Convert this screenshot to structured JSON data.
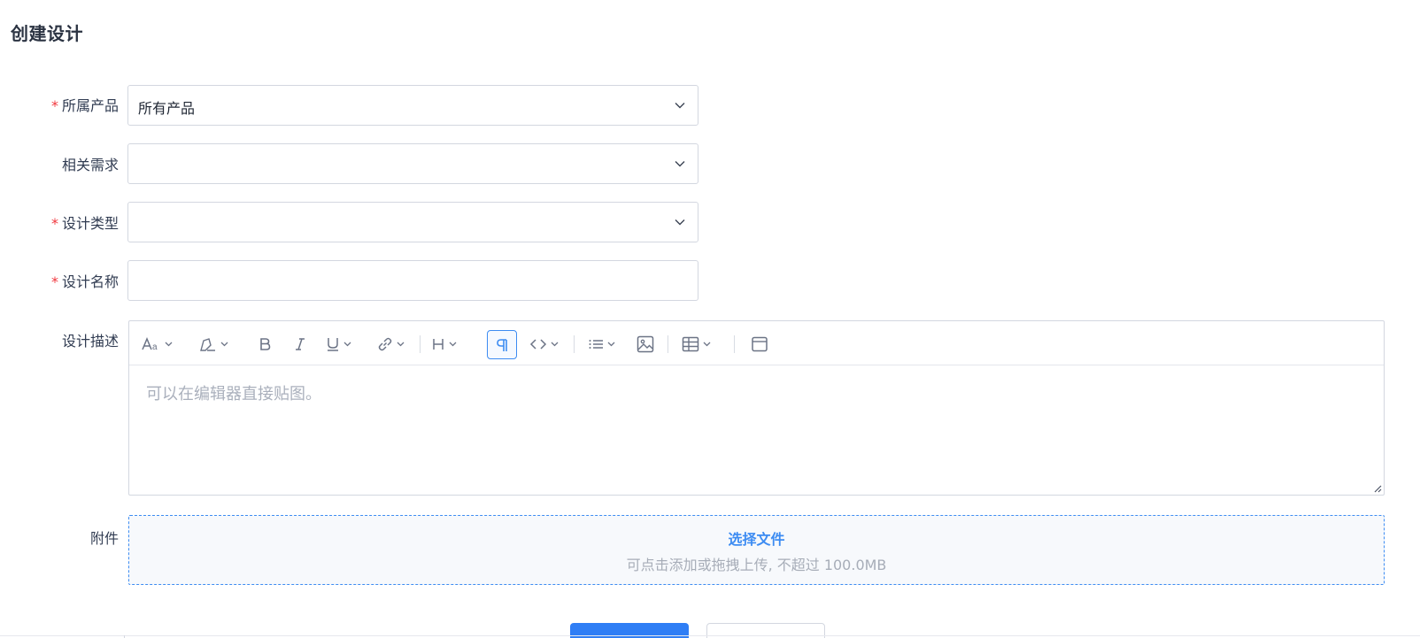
{
  "page": {
    "title": "创建设计"
  },
  "form": {
    "product": {
      "label": "所属产品",
      "required": true,
      "value": "所有产品"
    },
    "story": {
      "label": "相关需求",
      "required": false,
      "value": ""
    },
    "type": {
      "label": "设计类型",
      "required": true,
      "value": ""
    },
    "name": {
      "label": "设计名称",
      "required": true,
      "value": ""
    },
    "desc": {
      "label": "设计描述",
      "placeholder": "可以在编辑器直接贴图。"
    },
    "files": {
      "label": "附件",
      "action": "选择文件",
      "hint": "可点击添加或拖拽上传, 不超过 100.0MB"
    }
  },
  "required_mark": "*",
  "toolbar": [
    "font-size-icon",
    "highlight-icon",
    "bold-icon",
    "italic-icon",
    "underline-icon",
    "link-icon",
    "heading-icon",
    "paragraph-icon",
    "code-icon",
    "list-icon",
    "image-icon",
    "table-icon",
    "fullscreen-icon"
  ],
  "colors": {
    "accent": "#2f7ef5",
    "required": "#f1373e",
    "border": "#d3d7e0"
  }
}
